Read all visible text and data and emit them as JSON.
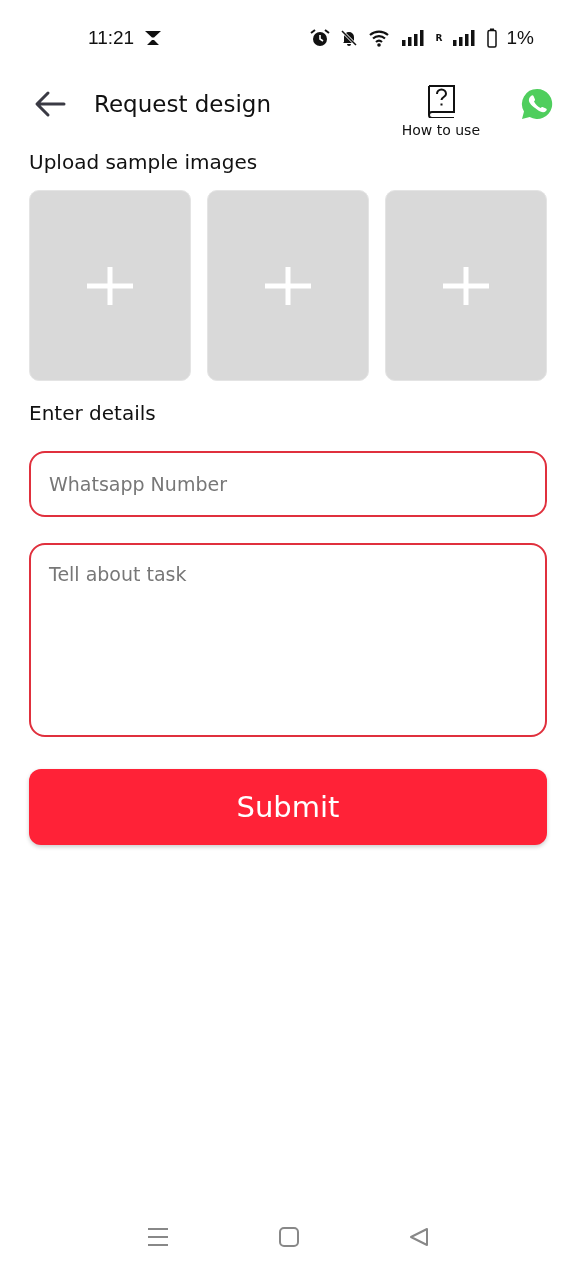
{
  "status_bar": {
    "time": "11:21",
    "roaming": "R",
    "battery": "1%"
  },
  "header": {
    "title": "Request design",
    "help_label": "How to use"
  },
  "upload": {
    "heading": "Upload sample images",
    "slots": [
      {
        "kind": "add"
      },
      {
        "kind": "add"
      },
      {
        "kind": "add"
      }
    ]
  },
  "details": {
    "heading": "Enter details",
    "fields": [
      {
        "kind": "line",
        "placeholder": "Whatsapp Number"
      },
      {
        "kind": "area",
        "placeholder": "Tell about task"
      }
    ]
  },
  "submit": {
    "label": "Submit"
  }
}
